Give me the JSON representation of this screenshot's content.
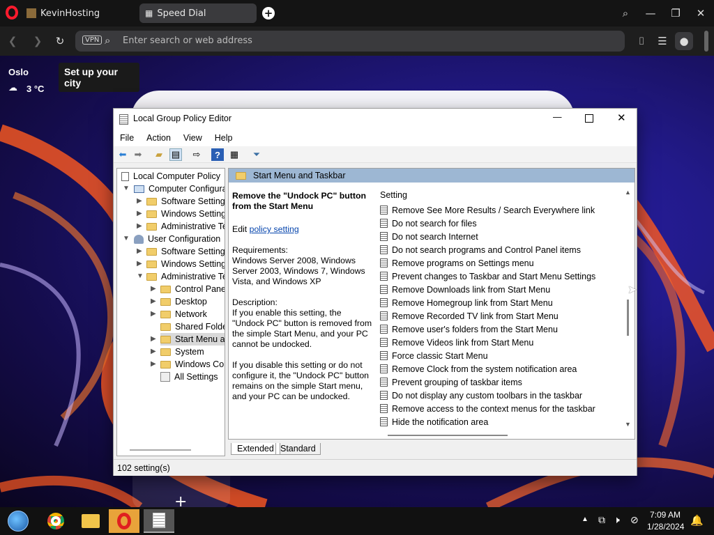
{
  "browser": {
    "tab1": "KevinHosting",
    "tab2": "Speed Dial",
    "vpn": "VPN",
    "address_placeholder": "Enter search or web address"
  },
  "weather": {
    "city": "Oslo",
    "tip": "Set up your city",
    "temp": "3 °C"
  },
  "gpe": {
    "title": "Local Group Policy Editor",
    "menu": [
      "File",
      "Action",
      "View",
      "Help"
    ],
    "tree": [
      {
        "label": "Local Computer Policy"
      },
      {
        "label": "Computer Configura"
      },
      {
        "label": "Software Settings"
      },
      {
        "label": "Windows Setting"
      },
      {
        "label": "Administrative Te"
      },
      {
        "label": "User Configuration"
      },
      {
        "label": "Software Settings"
      },
      {
        "label": "Windows Setting"
      },
      {
        "label": "Administrative Te"
      },
      {
        "label": "Control Panel"
      },
      {
        "label": "Desktop"
      },
      {
        "label": "Network"
      },
      {
        "label": "Shared Folder"
      },
      {
        "label": "Start Menu ar"
      },
      {
        "label": "System"
      },
      {
        "label": "Windows Cor"
      },
      {
        "label": "All Settings"
      }
    ],
    "section_title": "Start Menu and Taskbar",
    "desc_title": "Remove the \"Undock PC\" button from the Start Menu",
    "edit_prefix": "Edit ",
    "edit_link": "policy setting ",
    "requirements_label": "Requirements:",
    "requirements": "Windows Server 2008, Windows Server 2003, Windows 7, Windows Vista, and Windows XP",
    "description_label": "Description:",
    "desc_p1": "If you enable this setting, the \"Undock PC\" button is removed from the simple Start Menu, and your PC cannot be undocked.",
    "desc_p2": "If you disable this setting or do not configure it, the \"Undock PC\" button remains on the simple Start menu, and your PC can be undocked.",
    "setting_header": "Setting",
    "settings": [
      "Remove See More Results / Search Everywhere link",
      "Do not search for files",
      "Do not search Internet",
      "Do not search programs and Control Panel items",
      "Remove programs on Settings menu",
      "Prevent changes to Taskbar and Start Menu Settings",
      "Remove Downloads link from Start Menu",
      "Remove Homegroup link from Start Menu",
      "Remove Recorded TV link from Start Menu",
      "Remove user's folders from the Start Menu",
      "Remove Videos link from Start Menu",
      "Force classic Start Menu",
      "Remove Clock from the system notification area",
      "Prevent grouping of taskbar items",
      "Do not display any custom toolbars in the taskbar",
      "Remove access to the context menus for the taskbar",
      "Hide the notification area"
    ],
    "tab_extended": "Extended",
    "tab_standard": "Standard",
    "status": "102 setting(s)"
  },
  "taskbar": {
    "time": "7:09 AM",
    "date": "1/28/2024"
  }
}
